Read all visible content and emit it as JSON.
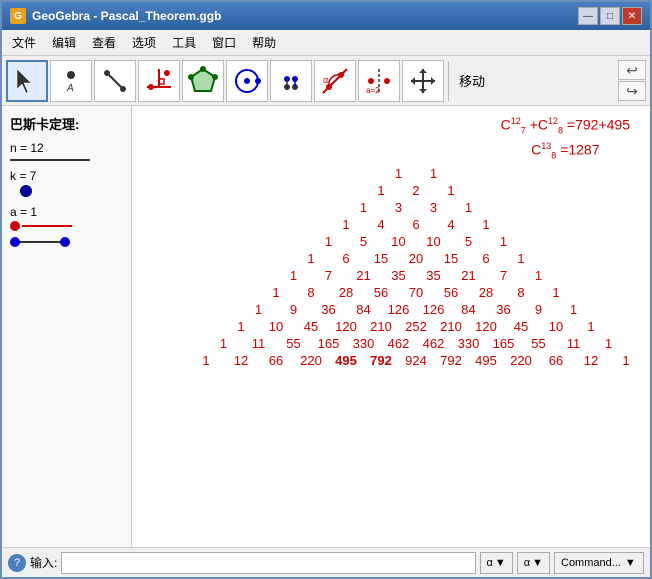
{
  "window": {
    "title": "GeoGebra - Pascal_Theorem.ggb",
    "icon": "G"
  },
  "titleButtons": {
    "minimize": "—",
    "maximize": "□",
    "close": "✕"
  },
  "menu": {
    "items": [
      "文件",
      "编辑",
      "查看",
      "选项",
      "工具",
      "窗口",
      "帮助"
    ]
  },
  "toolbar": {
    "moveLabel": "移动",
    "tools": [
      {
        "name": "cursor",
        "label": "cursor-tool"
      },
      {
        "name": "point",
        "label": "point-tool"
      },
      {
        "name": "line",
        "label": "line-tool"
      },
      {
        "name": "perpendicular",
        "label": "perpendicular-tool"
      },
      {
        "name": "polygon",
        "label": "polygon-tool"
      },
      {
        "name": "circle",
        "label": "circle-tool"
      },
      {
        "name": "ellipse",
        "label": "ellipse-tool"
      },
      {
        "name": "angle",
        "label": "angle-tool"
      },
      {
        "name": "reflect",
        "label": "reflect-tool"
      },
      {
        "name": "slider",
        "label": "slider-tool"
      },
      {
        "name": "move",
        "label": "move-view-tool"
      }
    ]
  },
  "leftPanel": {
    "title": "巴斯卡定理:",
    "nLabel": "n = 12",
    "kLabel": "k = 7",
    "aLabel": "a = 1"
  },
  "formula": {
    "line1a": "C",
    "line1b": "12",
    "line1bsup": "12",
    "line1bsub": "7",
    "line1c": "+C",
    "line1d": "12",
    "line1dsup": "12",
    "line1dsub": "8",
    "line1e": "=792+495",
    "line2a": "C",
    "line2b": "13",
    "line2bsup": "13",
    "line2bsub": "8",
    "line2c": "=1287",
    "display": "C₇¹²+C₈¹²=792+495",
    "display2": "C₈¹³=1287"
  },
  "pascal": {
    "rows": [
      [
        1,
        1
      ],
      [
        1,
        2,
        1
      ],
      [
        1,
        3,
        3,
        1
      ],
      [
        1,
        4,
        6,
        4,
        1
      ],
      [
        1,
        5,
        10,
        10,
        5,
        1
      ],
      [
        1,
        6,
        15,
        20,
        15,
        6,
        1
      ],
      [
        1,
        7,
        21,
        35,
        35,
        21,
        7,
        1
      ],
      [
        1,
        8,
        28,
        56,
        70,
        56,
        28,
        8,
        1
      ],
      [
        1,
        9,
        36,
        84,
        126,
        126,
        84,
        36,
        9,
        1
      ],
      [
        1,
        10,
        45,
        120,
        210,
        252,
        210,
        120,
        45,
        10,
        1
      ],
      [
        1,
        11,
        55,
        165,
        330,
        462,
        462,
        330,
        165,
        55,
        11,
        1
      ],
      [
        1,
        12,
        66,
        220,
        495,
        792,
        924,
        792,
        495,
        220,
        66,
        12,
        1
      ]
    ]
  },
  "statusBar": {
    "helpLabel": "?",
    "inputLabel": "输入:",
    "dropdown1": "α",
    "dropdown2": "α",
    "commandLabel": "Command..."
  }
}
